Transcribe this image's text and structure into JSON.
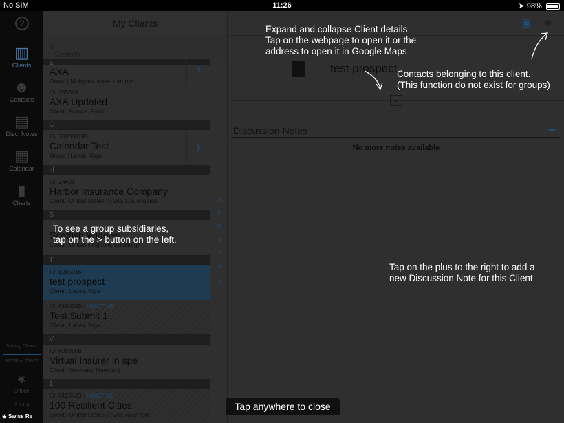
{
  "status_bar": {
    "carrier": "No SIM",
    "time": "11:26",
    "battery": "98%"
  },
  "sidebar": {
    "items": [
      {
        "label": "Clients",
        "icon": "building-icon"
      },
      {
        "label": "Contacts",
        "icon": "people-icon"
      },
      {
        "label": "Disc. Notes",
        "icon": "notes-icon"
      },
      {
        "label": "Calendar",
        "icon": "calendar-icon"
      },
      {
        "label": "Charts",
        "icon": "charts-icon"
      }
    ],
    "storing_label": "Storing Clients",
    "storing_count": "57750 of 77877",
    "offline_label": "Offline",
    "version": "2.5.1.0",
    "brand": "Swiss Re"
  },
  "list": {
    "title": "My Clients",
    "search_placeholder": "Search",
    "sections": [
      "A",
      "C",
      "H",
      "S",
      "T",
      "V",
      "1"
    ],
    "rows": [
      {
        "id": "",
        "name": "AXA",
        "sub": "Group | Malaysia, Kuala Lumpur"
      },
      {
        "id": "ID: 355899",
        "name": "AXA Updated",
        "sub": "Client | France, Paris"
      },
      {
        "id": "ID: 700000780",
        "name": "Calendar Test",
        "sub": "Group | Latvia, Riga"
      },
      {
        "id": "ID: 24491",
        "name": "Harbor Insurance Company",
        "sub": "Client | United States (USA), Los Angeles"
      },
      {
        "id": "",
        "name": "Scottish Widows",
        "sub": "Client | United Kingdom, Edinburgh"
      },
      {
        "id": "ID: 6205016",
        "name": "test prospect",
        "sub": "Client | Latvia, Riga"
      },
      {
        "id": "ID: 6190015",
        "status": "INACTIVE",
        "name": "Test Submit 1",
        "sub": "Client | Latvia, Riga"
      },
      {
        "id": "ID: 6208006",
        "name": "Virtual Insurer in spe",
        "sub": "Client | Germany, Hamburg"
      },
      {
        "id": "ID: 6126423",
        "status": "INACTIVE",
        "name": "100 Resilient Cities",
        "sub": "Client | United States (USA), New York"
      }
    ],
    "index": [
      "A",
      "C",
      "H",
      "S",
      "T",
      "V",
      "1"
    ]
  },
  "detail": {
    "title": "test prospect",
    "discussion_label": "Discussion Notes",
    "no_more": "No more notes available"
  },
  "overlay": {
    "hint_expand": "Expand and collapse Client details\nTap on the webpage to open it or the\naddress to open it in Google Maps",
    "hint_contacts": "Contacts belonging to this client.\n(This function do not exist for groups)",
    "hint_group": "To see a group subsidiaries,\ntap on the > button on the left.",
    "hint_plus": "Tap on the plus to the right to add a\nnew Discussion Note for this Client",
    "close": "Tap anywhere to close"
  }
}
